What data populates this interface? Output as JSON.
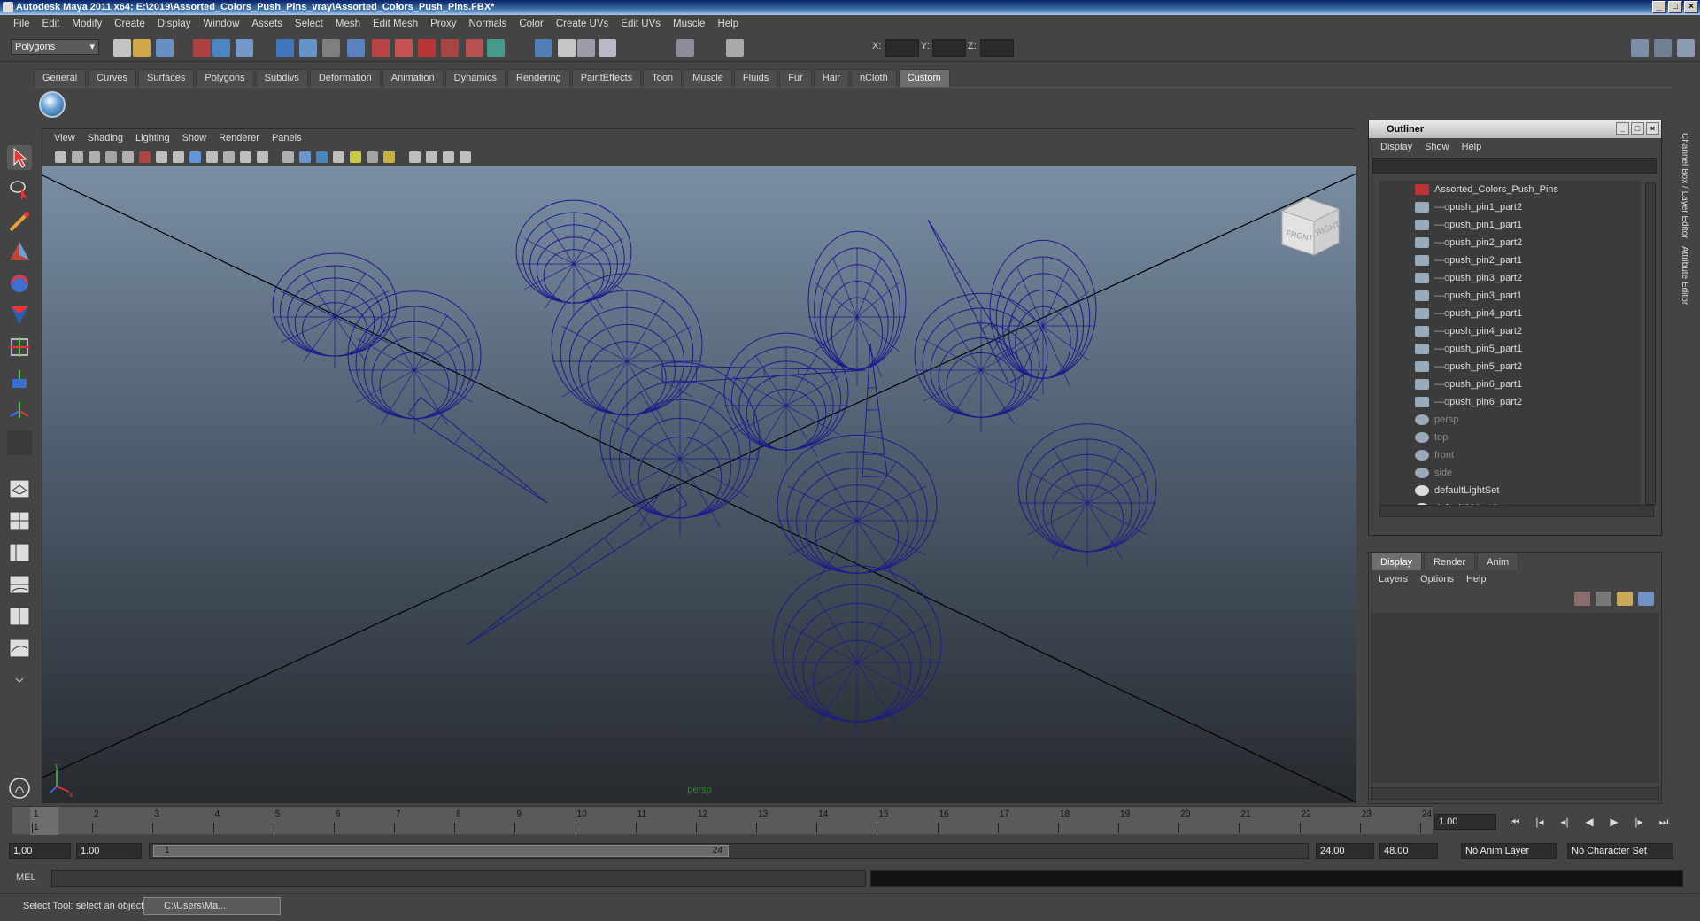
{
  "window": {
    "title": "Autodesk Maya 2011 x64: E:\\2019\\Assorted_Colors_Push_Pins_vray\\Assorted_Colors_Push_Pins.FBX*"
  },
  "menu": [
    "File",
    "Edit",
    "Modify",
    "Create",
    "Display",
    "Window",
    "Assets",
    "Select",
    "Mesh",
    "Edit Mesh",
    "Proxy",
    "Normals",
    "Color",
    "Create UVs",
    "Edit UVs",
    "Muscle",
    "Help"
  ],
  "status": {
    "mode": "Polygons",
    "x_label": "X:",
    "y_label": "Y:",
    "z_label": "Z:"
  },
  "shelf_tabs": [
    "General",
    "Curves",
    "Surfaces",
    "Polygons",
    "Subdivs",
    "Deformation",
    "Animation",
    "Dynamics",
    "Rendering",
    "PaintEffects",
    "Toon",
    "Muscle",
    "Fluids",
    "Fur",
    "Hair",
    "nCloth",
    "Custom"
  ],
  "shelf_active": "Custom",
  "viewport": {
    "menu": [
      "View",
      "Shading",
      "Lighting",
      "Show",
      "Renderer",
      "Panels"
    ],
    "camera_label": "persp",
    "viewcube": {
      "front": "FRONT",
      "right": "RIGHT"
    }
  },
  "outliner": {
    "title": "Outliner",
    "menu": [
      "Display",
      "Show",
      "Help"
    ],
    "items": [
      {
        "label": "Assorted_Colors_Push_Pins",
        "kind": "group",
        "dim": false
      },
      {
        "label": "push_pin1_part2",
        "kind": "mesh",
        "dim": false
      },
      {
        "label": "push_pin1_part1",
        "kind": "mesh",
        "dim": false
      },
      {
        "label": "push_pin2_part2",
        "kind": "mesh",
        "dim": false
      },
      {
        "label": "push_pin2_part1",
        "kind": "mesh",
        "dim": false
      },
      {
        "label": "push_pin3_part2",
        "kind": "mesh",
        "dim": false
      },
      {
        "label": "push_pin3_part1",
        "kind": "mesh",
        "dim": false
      },
      {
        "label": "push_pin4_part1",
        "kind": "mesh",
        "dim": false
      },
      {
        "label": "push_pin4_part2",
        "kind": "mesh",
        "dim": false
      },
      {
        "label": "push_pin5_part1",
        "kind": "mesh",
        "dim": false
      },
      {
        "label": "push_pin5_part2",
        "kind": "mesh",
        "dim": false
      },
      {
        "label": "push_pin6_part1",
        "kind": "mesh",
        "dim": false
      },
      {
        "label": "push_pin6_part2",
        "kind": "mesh",
        "dim": false
      },
      {
        "label": "persp",
        "kind": "camera",
        "dim": true
      },
      {
        "label": "top",
        "kind": "camera",
        "dim": true
      },
      {
        "label": "front",
        "kind": "camera",
        "dim": true
      },
      {
        "label": "side",
        "kind": "camera",
        "dim": true
      },
      {
        "label": "defaultLightSet",
        "kind": "set",
        "dim": false
      },
      {
        "label": "defaultObjectSet",
        "kind": "set",
        "dim": false
      }
    ]
  },
  "layers": {
    "tabs": [
      "Display",
      "Render",
      "Anim"
    ],
    "active_tab": "Display",
    "menu": [
      "Layers",
      "Options",
      "Help"
    ]
  },
  "side_tabs": [
    "Channel Box / Layer Editor",
    "Attribute Editor"
  ],
  "timeline": {
    "ticks": [
      "1",
      "2",
      "3",
      "4",
      "5",
      "6",
      "7",
      "8",
      "9",
      "10",
      "11",
      "12",
      "13",
      "14",
      "15",
      "16",
      "17",
      "18",
      "19",
      "20",
      "21",
      "22",
      "23",
      "24"
    ],
    "current_frame_label": "1",
    "current_time": "1.00"
  },
  "range": {
    "start": "1.00",
    "anim_start": "1.00",
    "thumb_start": "1",
    "thumb_end": "24",
    "end": "24.00",
    "anim_end": "48.00",
    "anim_layer": "No Anim Layer",
    "character_set": "No Character Set"
  },
  "command": {
    "label": "MEL"
  },
  "help": {
    "text": "Select Tool: select an object",
    "taskbar_button": "C:\\Users\\Ma..."
  },
  "colors": {
    "wire": "#1c1c8a",
    "accent": "#6e6e6e"
  }
}
